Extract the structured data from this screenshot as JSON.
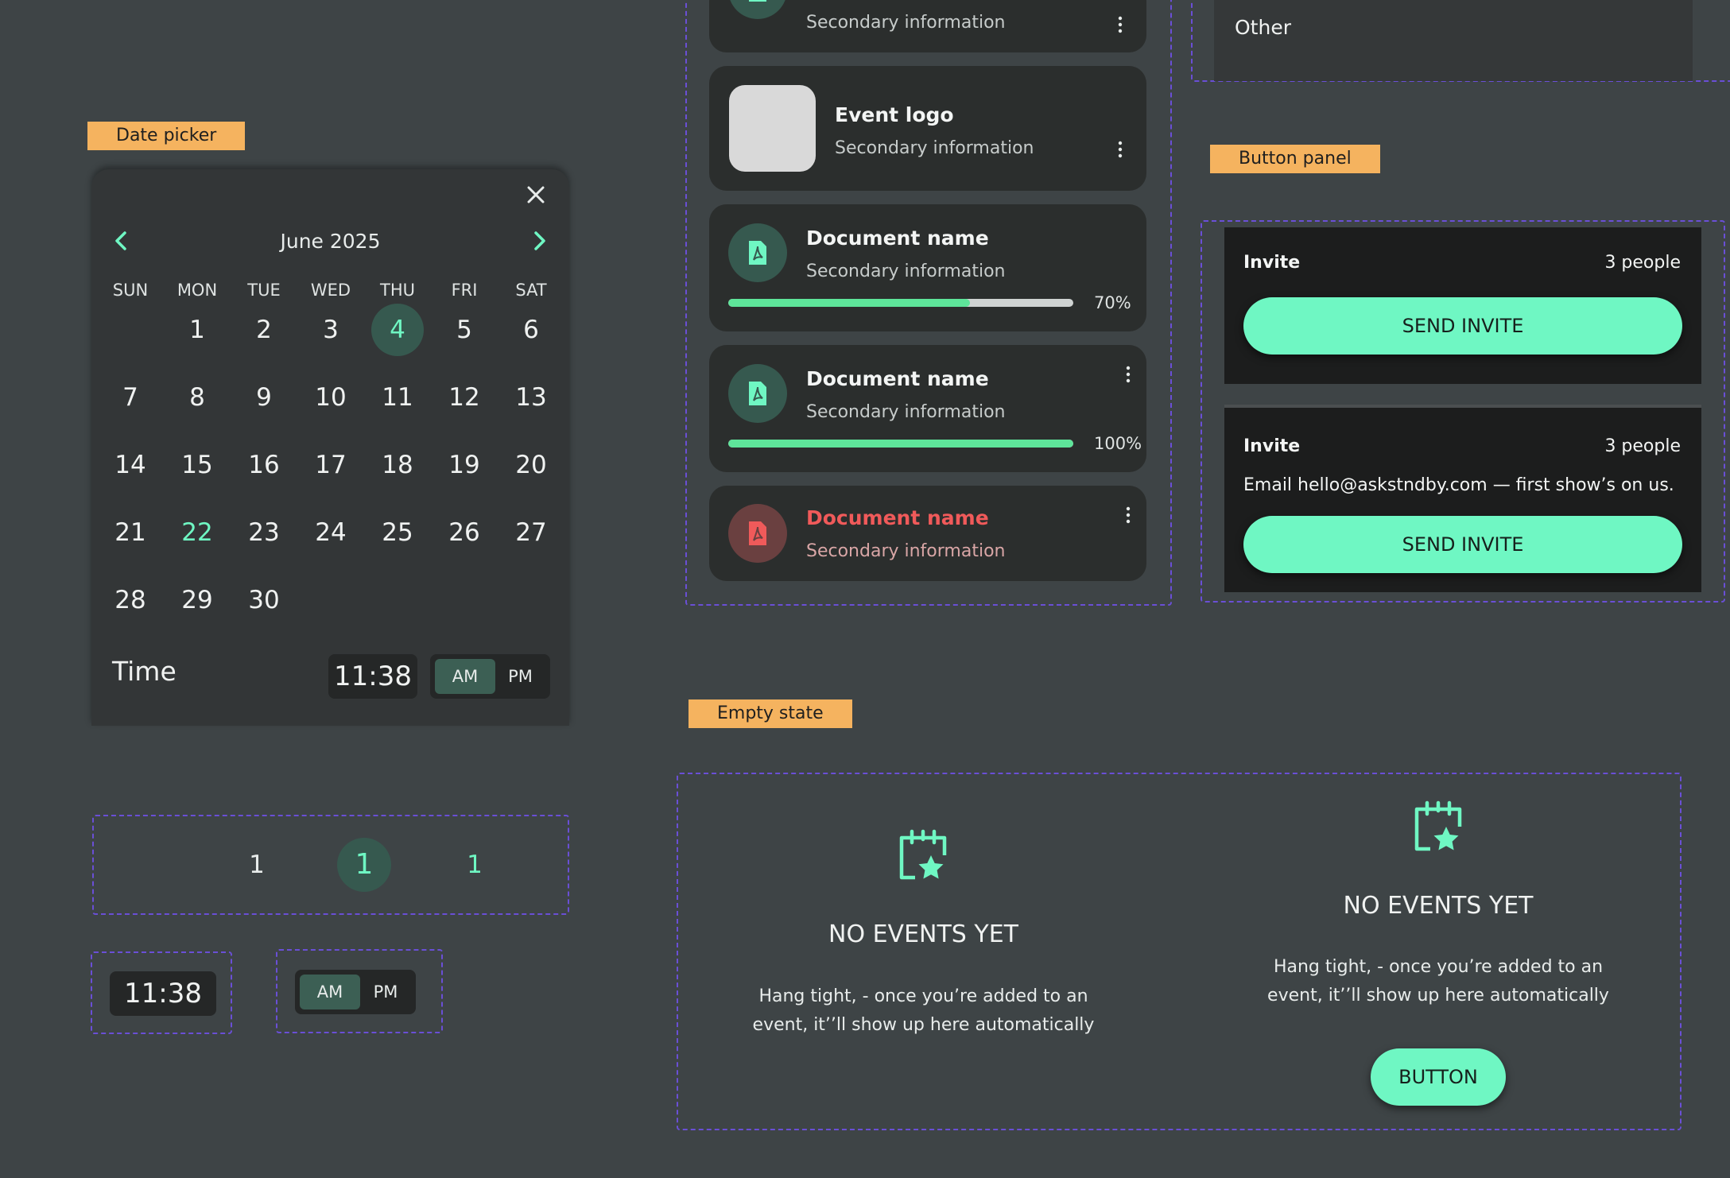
{
  "labels": {
    "date_picker": "Date picker",
    "button_panel": "Button panel",
    "empty_state": "Empty state"
  },
  "date_picker": {
    "month_label": "June 2025",
    "weekdays": [
      "SUN",
      "MON",
      "TUE",
      "WED",
      "THU",
      "FRI",
      "SAT"
    ],
    "days": [
      "1",
      "2",
      "3",
      "4",
      "5",
      "6",
      "7",
      "8",
      "9",
      "10",
      "11",
      "12",
      "13",
      "14",
      "15",
      "16",
      "17",
      "18",
      "19",
      "20",
      "21",
      "22",
      "23",
      "24",
      "25",
      "26",
      "27",
      "28",
      "29",
      "30"
    ],
    "selected_day": "4",
    "highlighted_day": "22",
    "time_label": "Time",
    "time_value": "11:38",
    "am": "AM",
    "pm": "PM",
    "icons": [
      "close-icon",
      "chevron-left-icon",
      "chevron-right-icon"
    ]
  },
  "pager": {
    "items": [
      "1",
      "1",
      "1"
    ]
  },
  "standalone_time": {
    "value": "11:38",
    "am": "AM",
    "pm": "PM"
  },
  "list": {
    "top_card_sub": "Secondary information",
    "event_card": {
      "title": "Event logo",
      "sub": "Secondary information"
    },
    "doc_progress": {
      "title": "Document name",
      "sub": "Secondary information",
      "percent_label": "70%",
      "progress": 0.7
    },
    "doc_complete": {
      "title": "Document name",
      "sub": "Secondary information",
      "percent_label": "100%",
      "progress": 1.0
    },
    "doc_error": {
      "title": "Document name",
      "sub": "Secondary information"
    }
  },
  "other_option": "Other",
  "button_panel": {
    "panel1": {
      "title": "Invite",
      "count": "3 people",
      "button": "SEND INVITE"
    },
    "panel2": {
      "title": "Invite",
      "count": "3 people",
      "text": "Email hello@askstndby.com — first show’s on us.",
      "button": "SEND INVITE"
    }
  },
  "empty_state": {
    "left": {
      "title": "NO EVENTS YET",
      "line1": "Hang tight, - once you’re added to an",
      "line2": "event, it’’ll show up here automatically"
    },
    "right": {
      "title": "NO EVENTS YET",
      "line1": "Hang tight, - once you’re added to an",
      "line2": "event, it’’ll show up here automatically",
      "button": "BUTTON"
    }
  },
  "colors": {
    "background": "#3e4446",
    "accent": "#6ff7c3",
    "selected": "#36594f",
    "tag": "#f5b35f",
    "error": "#f05a5a",
    "dashed": "#6a4fd6"
  }
}
